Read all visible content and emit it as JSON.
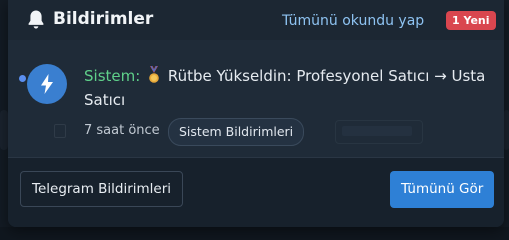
{
  "header": {
    "title": "Bildirimler",
    "mark_all_read": "Tümünü okundu yap",
    "new_badge": "1 Yeni",
    "bell_icon": "bell-icon"
  },
  "notifications": [
    {
      "unread": true,
      "icon": "lightning-bolt-icon",
      "source": "Sistem:",
      "emoji_icon": "medal-icon",
      "text": "Rütbe Yükseldin: Profesyonel Satıcı → Usta Satıcı",
      "time": "7 saat önce",
      "category": "Sistem Bildirimleri"
    }
  ],
  "footer": {
    "telegram_label": "Telegram Bildirimleri",
    "view_all_label": "Tümünü Gör"
  },
  "colors": {
    "accent": "#2e80d6",
    "badge": "#d9464f",
    "source": "#5fd08a",
    "link": "#8ec3f2"
  }
}
